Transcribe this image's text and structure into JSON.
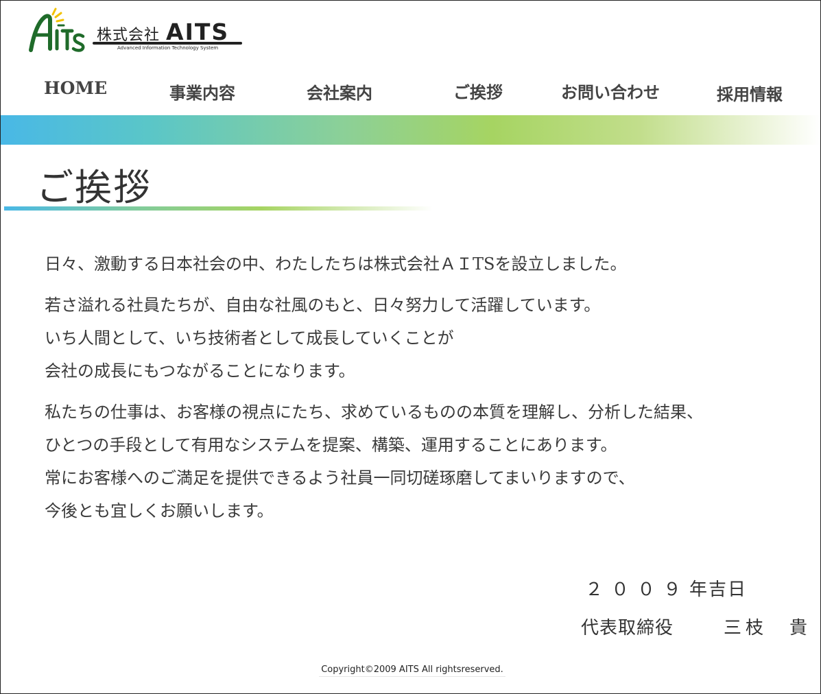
{
  "brand": {
    "company_prefix": "株式会社",
    "company_name": "AITS",
    "tagline": "Advanced Information Technology System",
    "logo_letters": "AITS"
  },
  "nav": {
    "items": [
      {
        "label": "HOME"
      },
      {
        "label": "事業内容"
      },
      {
        "label": "会社案内"
      },
      {
        "label": "ご挨拶"
      },
      {
        "label": "お問い合わせ"
      },
      {
        "label": "採用情報"
      }
    ]
  },
  "page": {
    "title": "ご挨拶"
  },
  "message": {
    "paragraphs": [
      {
        "lines": [
          "日々、激動する日本社会の中、わたしたちは株式会社ＡＩTSを設立しました。"
        ]
      },
      {
        "lines": [
          "若さ溢れる社員たちが、自由な社風のもと、日々努力して活躍しています。",
          "いち人間として、いち技術者として成長していくことが",
          "会社の成長にもつながることになります。"
        ]
      },
      {
        "lines": [
          "私たちの仕事は、お客様の視点にたち、求めているものの本質を理解し、分析した結果、",
          "ひとつの手段として有用なシステムを提案、構築、運用することにあります。",
          "常にお客様へのご満足を提供できるよう社員一同切磋琢磨してまいりますので、",
          "今後とも宜しくお願いします。"
        ]
      }
    ]
  },
  "signature": {
    "date_digits": "２００９",
    "date_tail": "年吉日",
    "role": "代表取締役",
    "name": "三枝　貴"
  },
  "footer": {
    "copyright": "Copyright©2009 AITS All rightsreserved."
  },
  "colors": {
    "band_start": "#49b8e6",
    "band_mid": "#a6d462",
    "logo_green": "#1f6b2a",
    "logo_yellow": "#f2c200"
  }
}
